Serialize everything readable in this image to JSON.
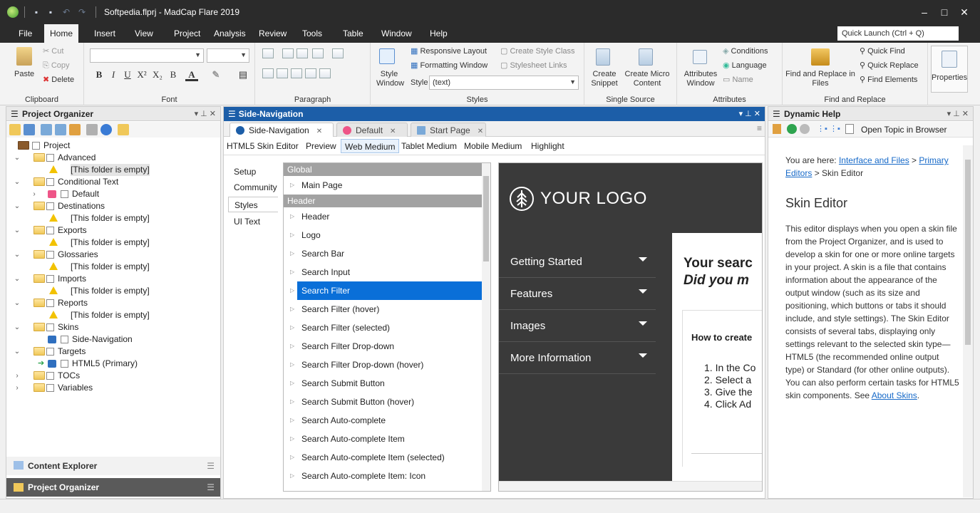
{
  "window": {
    "title": "Softpedia.flprj - MadCap Flare 2019"
  },
  "menu": {
    "items": [
      "File",
      "Home",
      "Insert",
      "View",
      "Project",
      "Analysis",
      "Review",
      "Tools",
      "Table",
      "Window",
      "Help"
    ],
    "active": "Home",
    "quick_launch": "Quick Launch (Ctrl + Q)"
  },
  "ribbon": {
    "clipboard": {
      "label": "Clipboard",
      "paste": "Paste",
      "cut": "Cut",
      "copy": "Copy",
      "delete": "Delete"
    },
    "font": {
      "label": "Font"
    },
    "paragraph": {
      "label": "Paragraph"
    },
    "styles": {
      "label": "Styles",
      "style_window": "Style Window",
      "responsive_layout": "Responsive Layout",
      "formatting_window": "Formatting Window",
      "style_prefix": "Style",
      "style_value": "(text)",
      "create_style_class": "Create Style Class",
      "stylesheet_links": "Stylesheet Links"
    },
    "single_source": {
      "label": "Single Source",
      "create_snippet": "Create Snippet",
      "create_micro_content": "Create Micro Content"
    },
    "attributes": {
      "label": "Attributes",
      "attributes_window": "Attributes Window",
      "conditions": "Conditions",
      "language": "Language",
      "name": "Name"
    },
    "find_replace": {
      "label": "Find and Replace",
      "find_and_replace_in_files": "Find and Replace in Files",
      "quick_find": "Quick Find",
      "quick_replace": "Quick Replace",
      "find_elements": "Find Elements"
    },
    "properties": {
      "label": "Properties"
    }
  },
  "project_organizer": {
    "title": "Project Organizer",
    "tree": [
      {
        "label": "Project",
        "level": 0,
        "type": "project"
      },
      {
        "label": "Advanced",
        "level": 1,
        "type": "folder",
        "expanded": true
      },
      {
        "label": "[This folder is empty]",
        "level": 2,
        "type": "warn",
        "selected": true
      },
      {
        "label": "Conditional Text",
        "level": 1,
        "type": "folder",
        "expanded": true
      },
      {
        "label": "Default",
        "level": 2,
        "type": "cond",
        "collapsed": true
      },
      {
        "label": "Destinations",
        "level": 1,
        "type": "folder",
        "expanded": true
      },
      {
        "label": "[This folder is empty]",
        "level": 2,
        "type": "warn"
      },
      {
        "label": "Exports",
        "level": 1,
        "type": "folder",
        "expanded": true
      },
      {
        "label": "[This folder is empty]",
        "level": 2,
        "type": "warn"
      },
      {
        "label": "Glossaries",
        "level": 1,
        "type": "folder",
        "expanded": true
      },
      {
        "label": "[This folder is empty]",
        "level": 2,
        "type": "warn"
      },
      {
        "label": "Imports",
        "level": 1,
        "type": "folder",
        "expanded": true
      },
      {
        "label": "[This folder is empty]",
        "level": 2,
        "type": "warn"
      },
      {
        "label": "Reports",
        "level": 1,
        "type": "folder",
        "expanded": true
      },
      {
        "label": "[This folder is empty]",
        "level": 2,
        "type": "warn"
      },
      {
        "label": "Skins",
        "level": 1,
        "type": "folder",
        "expanded": true
      },
      {
        "label": "Side-Navigation",
        "level": 2,
        "type": "skin"
      },
      {
        "label": "Targets",
        "level": 1,
        "type": "folder",
        "expanded": true
      },
      {
        "label": "HTML5 (Primary)",
        "level": 2,
        "type": "target"
      },
      {
        "label": "TOCs",
        "level": 1,
        "type": "folder",
        "collapsed": true
      },
      {
        "label": "Variables",
        "level": 1,
        "type": "folder",
        "collapsed": true
      }
    ],
    "bottom_tabs": [
      "Content Explorer",
      "Project Organizer"
    ]
  },
  "document": {
    "title": "Side-Navigation",
    "tabs": [
      {
        "label": "Side-Navigation",
        "active": true
      },
      {
        "label": "Default",
        "active": false
      },
      {
        "label": "Start Page",
        "active": false
      }
    ],
    "modes": [
      "HTML5 Skin Editor",
      "Preview",
      "Web Medium",
      "Tablet Medium",
      "Mobile Medium",
      "Highlight"
    ],
    "active_mode": "Web Medium",
    "side_tabs": [
      "Setup",
      "Community",
      "Styles",
      "UI Text"
    ],
    "active_side_tab": "Styles",
    "style_list": [
      {
        "kind": "header",
        "label": "Global"
      },
      {
        "kind": "item",
        "label": "Main Page"
      },
      {
        "kind": "header",
        "label": "Header"
      },
      {
        "kind": "item",
        "label": "Header"
      },
      {
        "kind": "item",
        "label": "Logo"
      },
      {
        "kind": "item",
        "label": "Search Bar"
      },
      {
        "kind": "item",
        "label": "Search Input"
      },
      {
        "kind": "item",
        "label": "Search Filter",
        "selected": true
      },
      {
        "kind": "item",
        "label": "Search Filter (hover)"
      },
      {
        "kind": "item",
        "label": "Search Filter (selected)"
      },
      {
        "kind": "item",
        "label": "Search Filter Drop-down"
      },
      {
        "kind": "item",
        "label": "Search Filter Drop-down (hover)"
      },
      {
        "kind": "item",
        "label": "Search Submit Button"
      },
      {
        "kind": "item",
        "label": "Search Submit Button (hover)"
      },
      {
        "kind": "item",
        "label": "Search Auto-complete"
      },
      {
        "kind": "item",
        "label": "Search Auto-complete Item"
      },
      {
        "kind": "item",
        "label": "Search Auto-complete Item (selected)"
      },
      {
        "kind": "item",
        "label": "Search Auto-complete Item: Icon"
      }
    ],
    "preview": {
      "logo_text": "YOUR LOGO",
      "nav_items": [
        "Getting Started",
        "Features",
        "Images",
        "More Information"
      ],
      "heading_line1": "Your searc",
      "heading_line2": "Did you m",
      "how_to": "How to create",
      "steps": [
        "1.  In the Co",
        "2.  Select a",
        "3.  Give the",
        "4.  Click Ad"
      ]
    }
  },
  "dynamic_help": {
    "title": "Dynamic Help",
    "open_topic": "Open Topic in Browser",
    "you_are_here": "You are here:",
    "crumb1": "Interface and Files",
    "crumb_sep": ">",
    "crumb2": "Primary Editors",
    "crumb3": "> Skin Editor",
    "heading": "Skin Editor",
    "body": "This editor displays when you open a skin file from the Project Organizer, and is used to develop a skin for one or more online targets in your project. A skin is a file that contains information about the appearance of the output window (such as its size and positioning, which buttons or tabs it should include, and style settings). The Skin Editor consists of several tabs, displaying only settings relevant to the selected skin type—HTML5 (the recommended online output type) or Standard (for other online outputs). You can also perform certain tasks for HTML5 skin components. See",
    "link_end": "About Skins",
    "link_end_suffix": "."
  },
  "colors": {
    "title_bg": "#2b2b2b",
    "accent": "#1c5ea8",
    "selection": "#0a6fd8",
    "preview_dark": "#3a3a3a"
  }
}
